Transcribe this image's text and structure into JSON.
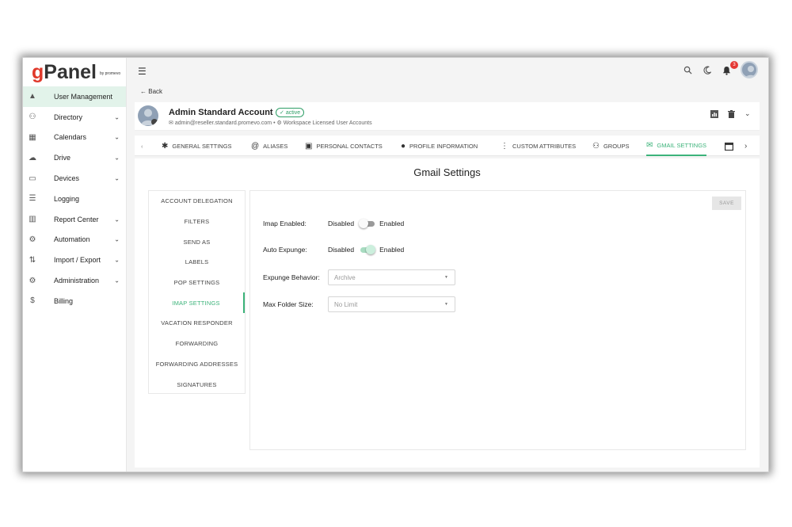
{
  "logo": {
    "g": "g",
    "rest": "Panel",
    "sub": "by promevo"
  },
  "sidebar": {
    "items": [
      {
        "label": "User Management",
        "icon": "person-icon",
        "glyph": "▲",
        "chevron": ""
      },
      {
        "label": "Directory",
        "icon": "people-icon",
        "glyph": "⚇",
        "chevron": "⌄"
      },
      {
        "label": "Calendars",
        "icon": "calendar-icon",
        "glyph": "▦",
        "chevron": "⌄"
      },
      {
        "label": "Drive",
        "icon": "drive-icon",
        "glyph": "☁",
        "chevron": "⌄"
      },
      {
        "label": "Devices",
        "icon": "devices-icon",
        "glyph": "▭",
        "chevron": "⌄"
      },
      {
        "label": "Logging",
        "icon": "list-icon",
        "glyph": "☰",
        "chevron": ""
      },
      {
        "label": "Report Center",
        "icon": "report-icon",
        "glyph": "▥",
        "chevron": "⌄"
      },
      {
        "label": "Automation",
        "icon": "automation-icon",
        "glyph": "⚙",
        "chevron": "⌄"
      },
      {
        "label": "Import / Export",
        "icon": "import-export-icon",
        "glyph": "⇅",
        "chevron": "⌄"
      },
      {
        "label": "Administration",
        "icon": "admin-gears-icon",
        "glyph": "⚙",
        "chevron": "⌄"
      },
      {
        "label": "Billing",
        "icon": "dollar-icon",
        "glyph": "$",
        "chevron": ""
      }
    ]
  },
  "topbar": {
    "notification_count": "3"
  },
  "back_label": "Back",
  "account": {
    "name": "Admin Standard Account",
    "status": "active",
    "email": "admin@reseller.standard.promevo.com",
    "org": "Workspace Licensed User Accounts"
  },
  "tabs": [
    {
      "label": "GENERAL SETTINGS",
      "icon": "gear-icon",
      "glyph": "✱"
    },
    {
      "label": "ALIASES",
      "icon": "at-icon",
      "glyph": "@"
    },
    {
      "label": "PERSONAL CONTACTS",
      "icon": "contacts-icon",
      "glyph": "▣"
    },
    {
      "label": "PROFILE INFORMATION",
      "icon": "info-icon",
      "glyph": "●"
    },
    {
      "label": "CUSTOM ATTRIBUTES",
      "icon": "attributes-icon",
      "glyph": "⋮"
    },
    {
      "label": "GROUPS",
      "icon": "groups-icon",
      "glyph": "⚇"
    },
    {
      "label": "GMAIL SETTINGS",
      "icon": "mail-icon",
      "glyph": "✉"
    }
  ],
  "main": {
    "title": "Gmail Settings",
    "subnav": [
      "ACCOUNT DELEGATION",
      "FILTERS",
      "SEND AS",
      "LABELS",
      "POP SETTINGS",
      "IMAP SETTINGS",
      "VACATION RESPONDER",
      "FORWARDING",
      "FORWARDING ADDRESSES",
      "SIGNATURES"
    ],
    "active_subnav": "IMAP SETTINGS",
    "save_label": "SAVE",
    "imap_enabled": {
      "label": "Imap Enabled:",
      "off_label": "Disabled",
      "on_label": "Enabled",
      "value": false
    },
    "auto_expunge": {
      "label": "Auto Expunge:",
      "off_label": "Disabled",
      "on_label": "Enabled",
      "value": true
    },
    "expunge_behavior": {
      "label": "Expunge Behavior:",
      "value": "Archive"
    },
    "max_folder_size": {
      "label": "Max Folder Size:",
      "value": "No Limit"
    }
  },
  "colors": {
    "accent": "#3cb37a",
    "active_bg": "#e2f3ea",
    "logo_g": "#e0392b",
    "badge": "#e53935"
  }
}
